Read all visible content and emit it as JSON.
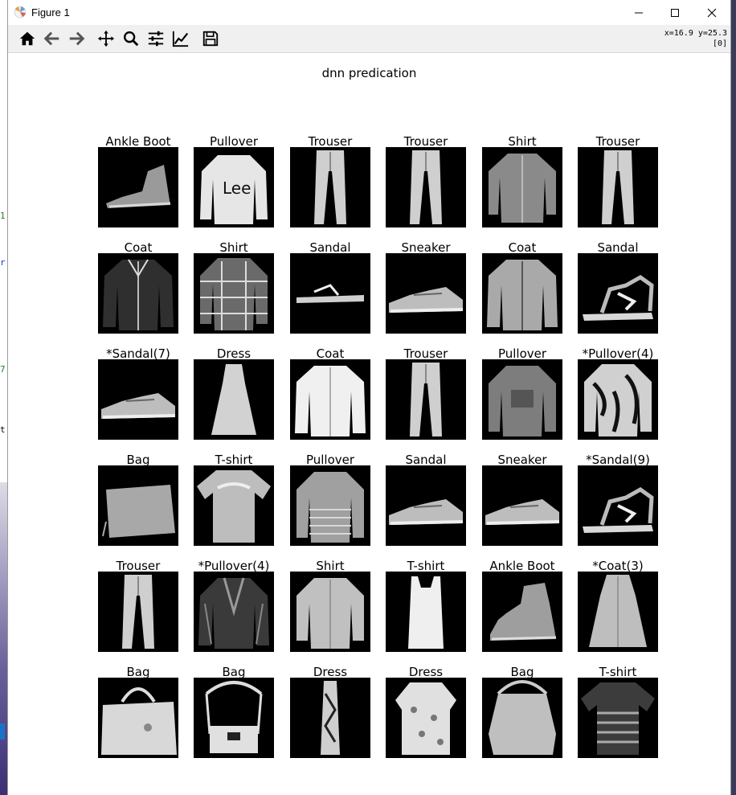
{
  "window": {
    "title": "Figure 1",
    "minimize_icon": "minimize-icon",
    "maximize_icon": "maximize-icon",
    "close_icon": "close-icon"
  },
  "toolbar": {
    "buttons": [
      "home-icon",
      "back-icon",
      "forward-icon",
      "pan-icon",
      "zoom-icon",
      "configure-subplots-icon",
      "edit-axis-icon",
      "save-icon"
    ],
    "coords_line1": "x=16.9 y=25.3",
    "coords_line2": "[0]"
  },
  "figure": {
    "title": "dnn predication",
    "rows": [
      [
        "Ankle Boot",
        "Pullover",
        "Trouser",
        "Trouser",
        "Shirt",
        "Trouser"
      ],
      [
        "Coat",
        "Shirt",
        "Sandal",
        "Sneaker",
        "Coat",
        "Sandal"
      ],
      [
        "*Sandal(7)",
        "Dress",
        "Coat",
        "Trouser",
        "Pullover",
        "*Pullover(4)"
      ],
      [
        "Bag",
        "T-shirt",
        "Pullover",
        "Sandal",
        "Sneaker",
        "*Sandal(9)"
      ],
      [
        "Trouser",
        "*Pullover(4)",
        "Shirt",
        "T-shirt",
        "Ankle Boot",
        "*Coat(3)"
      ],
      [
        "Bag",
        "Bag",
        "Dress",
        "Dress",
        "Bag",
        "T-shirt"
      ]
    ]
  },
  "background": {
    "left_marks": [
      "1",
      "r",
      "7",
      "t"
    ]
  }
}
